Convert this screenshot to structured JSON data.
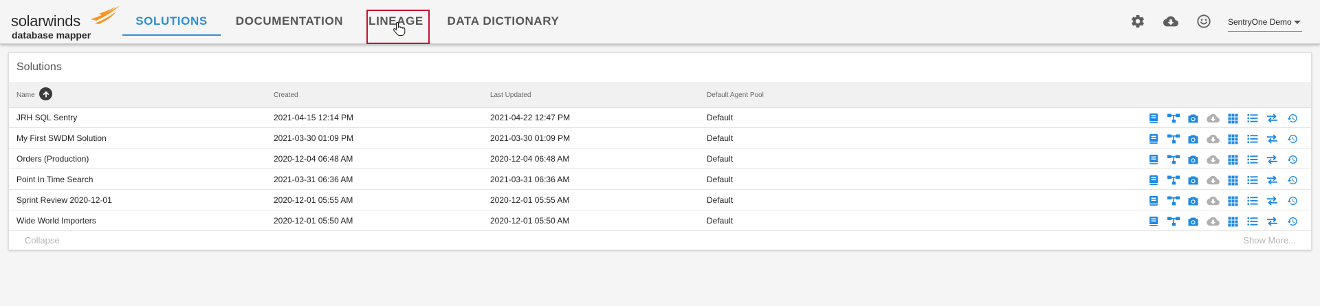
{
  "brand": {
    "name": "solarwinds",
    "product": "database mapper",
    "flame_color": "#f7941d"
  },
  "nav": {
    "tabs": [
      {
        "label": "SOLUTIONS",
        "active": true
      },
      {
        "label": "DOCUMENTATION",
        "active": false
      },
      {
        "label": "LINEAGE",
        "active": false
      },
      {
        "label": "DATA DICTIONARY",
        "active": false
      }
    ]
  },
  "header": {
    "icons": [
      "settings-icon",
      "cloud-download-icon",
      "smiley-icon"
    ],
    "user": "SentryOne Demo"
  },
  "solutions": {
    "title": "Solutions",
    "columns": [
      "Name",
      "Created",
      "Last Updated",
      "Default Agent Pool"
    ],
    "rows": [
      {
        "name": "JRH SQL Sentry",
        "created": "2021-04-15 12:14 PM",
        "updated": "2021-04-22 12:47 PM",
        "pool": "Default"
      },
      {
        "name": "My First SWDM Solution",
        "created": "2021-03-30 01:09 PM",
        "updated": "2021-03-30 01:09 PM",
        "pool": "Default"
      },
      {
        "name": "Orders (Production)",
        "created": "2020-12-04 06:48 AM",
        "updated": "2020-12-04 06:48 AM",
        "pool": "Default"
      },
      {
        "name": "Point In Time Search",
        "created": "2021-03-31 06:36 AM",
        "updated": "2021-03-31 06:36 AM",
        "pool": "Default"
      },
      {
        "name": "Sprint Review 2020-12-01",
        "created": "2020-12-01 05:55 AM",
        "updated": "2020-12-01 05:55 AM",
        "pool": "Default"
      },
      {
        "name": "Wide World Importers",
        "created": "2020-12-01 05:50 AM",
        "updated": "2020-12-01 05:50 AM",
        "pool": "Default"
      }
    ],
    "row_actions": [
      "book-icon",
      "lineage-tree-icon",
      "camera-icon",
      "cloud-download-icon",
      "grid-icon",
      "list-icon",
      "swap-icon",
      "history-icon"
    ],
    "collapse_label": "Collapse",
    "show_more_label": "Show More..."
  },
  "colors": {
    "accent": "#2d8fd6",
    "icon_blue": "#1e88e5",
    "icon_disabled": "#b0b0b0",
    "highlight": "#c8102e"
  }
}
